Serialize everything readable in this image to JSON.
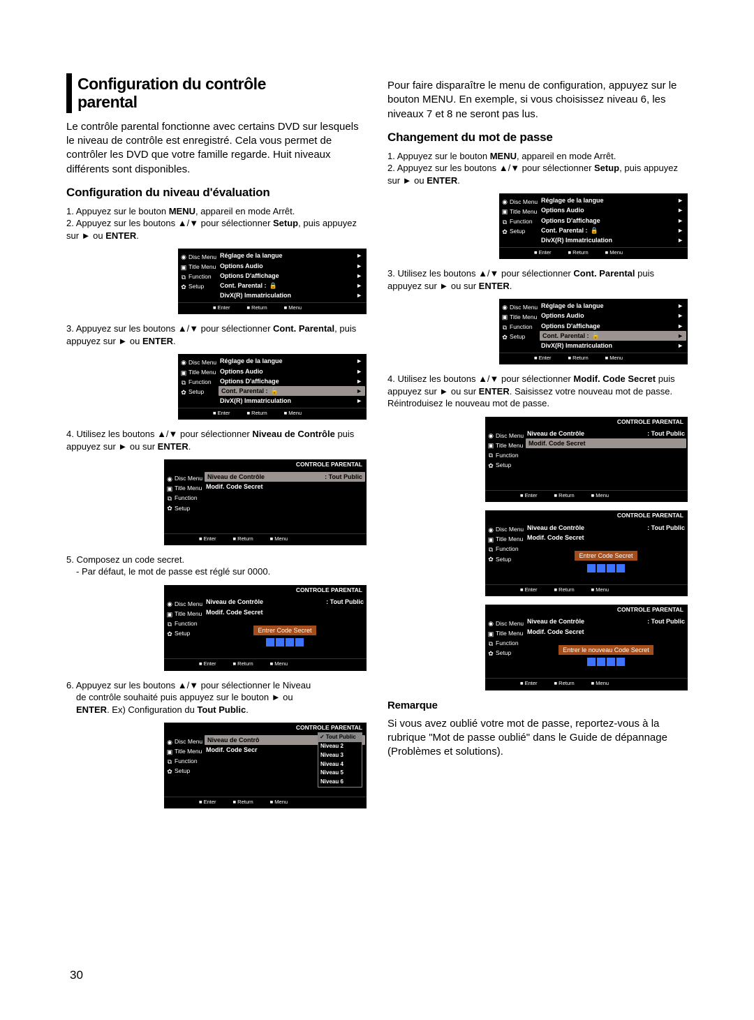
{
  "page_number": "30",
  "left": {
    "h1_l1": "Configuration du contrôle",
    "h1_l2": "parental",
    "intro": "Le contrôle parental fonctionne avec certains DVD sur lesquels le niveau de contrôle est enregistré. Cela vous permet de contrôler les DVD que votre famille regarde. Huit niveaux différents sont disponibles.",
    "sub1": "Configuration du niveau d'évaluation",
    "s1": "1. Appuyez sur le bouton ",
    "s1b": "MENU",
    "s1c": ", appareil en mode Arrêt.",
    "s2": "2. Appuyez sur les boutons ▲/▼ pour sélectionner ",
    "s2b": "Setup",
    "s2c": ", puis appuyez sur ► ou ",
    "s2d": "ENTER",
    "s2e": ".",
    "s3": "3. Appuyez sur les boutons ▲/▼ pour sélectionner ",
    "s3b": "Cont. Parental",
    "s3c": ", puis appuyez sur ► ou ",
    "s3d": "ENTER",
    "s3e": ".",
    "s4": "4. Utilisez les boutons ▲/▼ pour sélectionner ",
    "s4b": "Niveau de Contrôle",
    "s4c": " puis appuyez sur ► ou sur ",
    "s4d": "ENTER",
    "s4e": ".",
    "s5": "5. Composez un code secret.",
    "s5a": "- Par défaut, le mot de passe est réglé sur 0000.",
    "s6a": "6. Appuyez sur les boutons ▲/▼ pour sélectionner le Niveau",
    "s6b": "de contrôle souhaité puis appuyez sur le bouton ► ou",
    "s6c_pre": "ENTER",
    "s6c_mid": ". Ex) Configuration du ",
    "s6c_bold2": "Tout Public",
    "s6c_end": "."
  },
  "right": {
    "intro": "Pour faire disparaître le menu de configuration, appuyez sur le bouton MENU. En exemple, si vous choisissez niveau 6, les niveaux 7 et 8 ne seront pas lus.",
    "sub1": "Changement du mot de passe",
    "s1": "1. Appuyez sur le bouton ",
    "s1b": "MENU",
    "s1c": ", appareil en mode Arrêt.",
    "s2": "2. Appuyez sur les boutons ▲/▼ pour sélectionner ",
    "s2b": "Setup",
    "s2c": ", puis appuyez sur ► ou ",
    "s2d": "ENTER",
    "s2e": ".",
    "s3": "3. Utilisez les boutons ▲/▼ pour sélectionner ",
    "s3b": "Cont. Parental",
    "s3c": " puis appuyez sur ► ou sur ",
    "s3d": "ENTER",
    "s3e": ".",
    "s4": "4. Utilisez les boutons ▲/▼ pour sélectionner ",
    "s4b": "Modif. Code Secret",
    "s4c": " puis appuyez sur ► ou sur ",
    "s4d": "ENTER",
    "s4e": ". Saisissez votre nouveau mot de passe. Réintroduisez le nouveau mot de passe.",
    "note_h": "Remarque",
    "note": "Si vous avez oublié votre mot de passe, reportez-vous à la rubrique \"Mot de passe oublié\" dans le Guide de dépannage (Problèmes et solutions)."
  },
  "menu": {
    "side1": "Disc Menu",
    "side2": "Title Menu",
    "side3": "Function",
    "side4": "Setup",
    "o1": "Réglage de la langue",
    "o2": "Options Audio",
    "o3": "Options D'affichage",
    "o4": "Cont. Parental :",
    "o5": "DivX(R) Immatriculation",
    "arr": "►",
    "f1": "■ Enter",
    "f2": "■ Return",
    "f3": "■ Menu"
  },
  "panel": {
    "title": "CONTROLE PARENTAL",
    "r1": "Niveau de Contrôle",
    "r1v": ": Tout Public",
    "r2": "Modif. Code Secret",
    "entrer": "Entrer Code Secret",
    "nouveau": "Entrer le nouveau Code Secret",
    "trunc_r1": "Niveau de Contrô",
    "trunc_r2": "Modif. Code Secr"
  },
  "dropdown": {
    "d0": "Tout Public",
    "d1": "Niveau 2",
    "d2": "Niveau 3",
    "d3": "Niveau 4",
    "d4": "Niveau 5",
    "d5": "Niveau 6"
  }
}
